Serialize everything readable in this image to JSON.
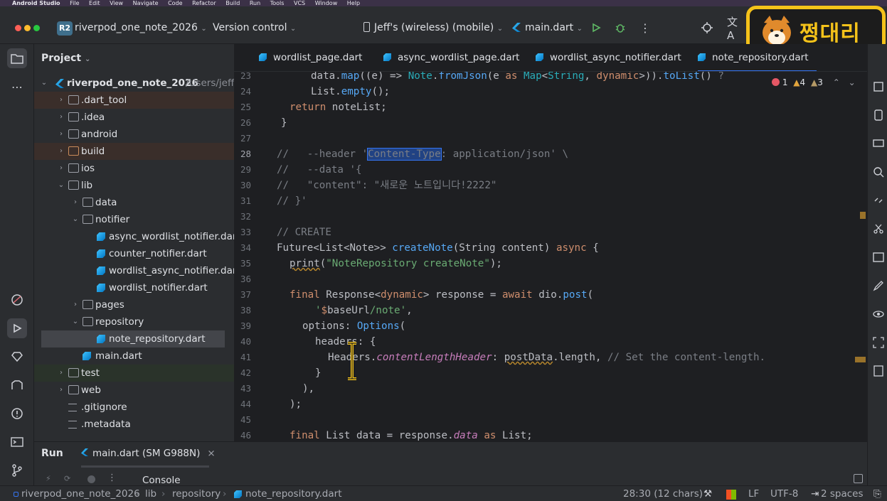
{
  "macos_menu": {
    "app": "Android Studio",
    "items": [
      "File",
      "Edit",
      "View",
      "Navigate",
      "Code",
      "Refactor",
      "Build",
      "Run",
      "Tools",
      "VCS",
      "Window",
      "Help"
    ]
  },
  "toolbar": {
    "project_badge": "R2",
    "project_name": "riverpod_one_note_2026",
    "version_control": "Version control",
    "device": "Jeff's (wireless) (mobile)",
    "run_config": "main.dart"
  },
  "overlay_logo": {
    "text": "쩡대리"
  },
  "project_panel": {
    "title": "Project",
    "root": {
      "name": "riverpod_one_note_2026",
      "path": "/Users/jeff/"
    },
    "items": [
      {
        "label": ".dart_tool",
        "depth": 1,
        "kind": "folder",
        "expanded": false
      },
      {
        "label": ".idea",
        "depth": 1,
        "kind": "folder",
        "expanded": false
      },
      {
        "label": "android",
        "depth": 1,
        "kind": "folder",
        "expanded": false
      },
      {
        "label": "build",
        "depth": 1,
        "kind": "folder",
        "expanded": false
      },
      {
        "label": "ios",
        "depth": 1,
        "kind": "folder",
        "expanded": false
      },
      {
        "label": "lib",
        "depth": 1,
        "kind": "folder",
        "expanded": true
      },
      {
        "label": "data",
        "depth": 2,
        "kind": "folder",
        "expanded": false
      },
      {
        "label": "notifier",
        "depth": 2,
        "kind": "folder",
        "expanded": true
      },
      {
        "label": "async_wordlist_notifier.dart",
        "depth": 3,
        "kind": "dart"
      },
      {
        "label": "counter_notifier.dart",
        "depth": 3,
        "kind": "dart"
      },
      {
        "label": "wordlist_async_notifier.dart",
        "depth": 3,
        "kind": "dart"
      },
      {
        "label": "wordlist_notifier.dart",
        "depth": 3,
        "kind": "dart"
      },
      {
        "label": "pages",
        "depth": 2,
        "kind": "folder",
        "expanded": false
      },
      {
        "label": "repository",
        "depth": 2,
        "kind": "folder",
        "expanded": true
      },
      {
        "label": "note_repository.dart",
        "depth": 3,
        "kind": "dart",
        "selected": true
      },
      {
        "label": "main.dart",
        "depth": 2,
        "kind": "dart"
      },
      {
        "label": "test",
        "depth": 1,
        "kind": "folder",
        "expanded": false
      },
      {
        "label": "web",
        "depth": 1,
        "kind": "folder",
        "expanded": false
      },
      {
        "label": ".gitignore",
        "depth": 1,
        "kind": "file"
      },
      {
        "label": ".metadata",
        "depth": 1,
        "kind": "file"
      }
    ]
  },
  "editor": {
    "tabs": [
      {
        "label": "wordlist_page.dart"
      },
      {
        "label": "async_wordlist_page.dart"
      },
      {
        "label": "wordlist_async_notifier.dart"
      },
      {
        "label": "note_repository.dart",
        "active": true
      }
    ],
    "inspections": {
      "errors": "1",
      "warnings": "4",
      "weak_warnings": "3"
    },
    "line_numbers": [
      "23",
      "24",
      "25",
      "26",
      "27",
      "28",
      "29",
      "30",
      "31",
      "32",
      "33",
      "34",
      "35",
      "36",
      "37",
      "38",
      "39",
      "40",
      "41",
      "42",
      "43",
      "44",
      "45",
      "46"
    ],
    "current_line": "28",
    "code_lines": [
      "      data.map((e) => Note.fromJson(e as Map<String, dynamic>)).toList() ?",
      "      List.empty();",
      "  return noteList;",
      "}",
      "",
      "//   --header 'Content-Type: application/json' \\",
      "//   --data '{",
      "//   \"content\": \"새로운 노트입니다!2222\"",
      "// }'",
      "",
      "// CREATE",
      "Future<List<Note>> createNote(String content) async {",
      "  print(\"NoteRepository createNote\");",
      "",
      "  final Response<dynamic> response = await dio.post(",
      "      '$baseUrl/note',",
      "    options: Options(",
      "      headers: {",
      "        Headers.contentLengthHeader: postData.length, // Set the content-length.",
      "      }",
      "    ),",
      "  );",
      "",
      "  final List data = response.data as List;"
    ]
  },
  "bottom_panel": {
    "run_label": "Run",
    "run_tab": "main.dart (SM G988N)",
    "console_label": "Console"
  },
  "statusbar": {
    "breadcrumb": [
      "riverpod_one_note_2026",
      "lib",
      "repository",
      "note_repository.dart"
    ],
    "position": "28:30 (12 chars)",
    "line_separator": "LF",
    "encoding": "UTF-8",
    "indent": "2 spaces"
  },
  "colors": {
    "accent": "#3574f0",
    "keyword": "#cf8e6d",
    "function": "#56a8f5",
    "type": "#2aacb8",
    "string": "#6aab73",
    "comment": "#7a7e85",
    "logo_yellow": "#f4c21a"
  }
}
